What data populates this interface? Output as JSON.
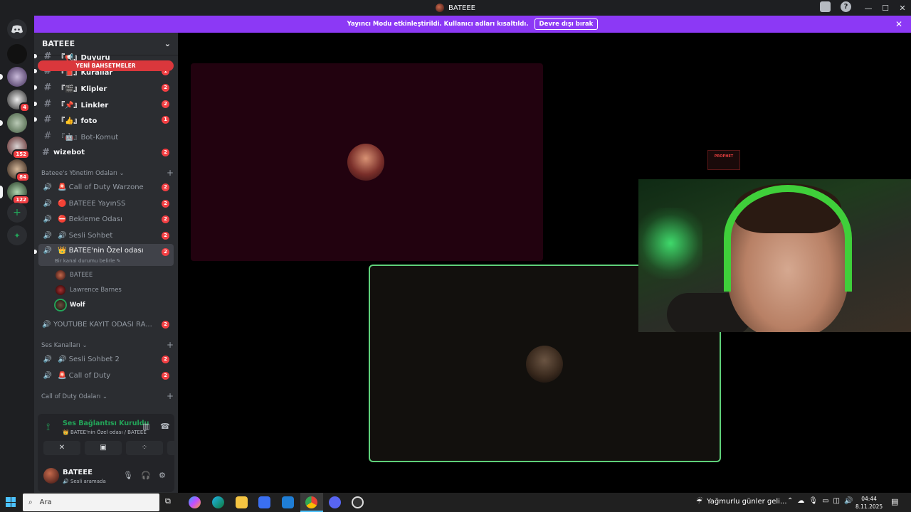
{
  "window": {
    "title": "BATEEE",
    "min": "—",
    "max": "☐",
    "close": "✕"
  },
  "banner": {
    "text": "Yayıncı Modu etkinleştirildi. Kullanıcı adları kısaltıldı.",
    "button": "Devre dışı bırak",
    "close": "✕"
  },
  "servers": {
    "badges": [
      "4",
      "152",
      "84",
      "122"
    ],
    "add": "+",
    "explore": "✦"
  },
  "guild": {
    "name": "BATEEE",
    "chevron": "⌄",
    "new_mentions": "YENİ BAHSETMELER",
    "text_channels": [
      {
        "label": "『📢』Duyuru",
        "badge": "",
        "unread": true
      },
      {
        "label": "『📕』Kurallar",
        "badge": "1",
        "unread": true
      },
      {
        "label": "『🎬』Klipler",
        "badge": "2",
        "unread": true
      },
      {
        "label": "『📌』Linkler",
        "badge": "2",
        "unread": true
      },
      {
        "label": "『👍』foto",
        "badge": "1",
        "unread": true
      },
      {
        "label": "『🤖』Bot-Komut",
        "badge": "",
        "unread": false
      },
      {
        "label": "wizebot",
        "badge": "2",
        "unread": true
      }
    ],
    "category_admin": "Bateee's Yönetim Odaları ⌄",
    "admin_channels": [
      {
        "label": "🚨 Call of Duty Warzone",
        "badge": "2"
      },
      {
        "label": "🔴 BATEEE YayınSS",
        "badge": "2"
      },
      {
        "label": "⛔ Bekleme Odası",
        "badge": "2"
      },
      {
        "label": "🔊 Sesli Sohbet",
        "badge": "2"
      },
      {
        "label": "👑 BATEE'nin Özel odası",
        "badge": "2"
      }
    ],
    "status_set": "Bir kanal durumu belirle ✎",
    "voice_users": [
      {
        "name": "BATEEE",
        "speaking": false
      },
      {
        "name": "Lawrence Barnes",
        "speaking": false
      },
      {
        "name": "Wolf",
        "speaking": true
      }
    ],
    "youtube_channel": {
      "label": "YOUTUBE KAYIT ODASI RA...",
      "badge": "2"
    },
    "category_voice": "Ses Kanalları ⌄",
    "voice_channels": [
      {
        "label": "🔊 Sesli Sohbet 2",
        "badge": "2"
      },
      {
        "label": "🚨 Call of Duty",
        "badge": "2"
      }
    ],
    "category_cod": "Call of Duty Odaları ⌄",
    "plus": "+"
  },
  "voice_panel": {
    "title": "Ses Bağlantısı Kuruldu",
    "subtitle": "👑 BATEE'nin Özel odası / BATEEE",
    "buttons": [
      "✕",
      "▣",
      "⁘",
      "✺"
    ]
  },
  "user": {
    "name": "BATEEE",
    "status": "🔊 Sesli aramada"
  },
  "stage": {
    "logo_text": "PROPHET"
  },
  "taskbar": {
    "search_placeholder": "Ara",
    "weather": "Yağmurlu günler geli...",
    "time": "04:44",
    "date": "8.11.2025"
  },
  "colors": {
    "accent": "#8c39f5",
    "danger": "#f23f43",
    "online": "#23a559",
    "speaking_border": "#5fd17a"
  }
}
